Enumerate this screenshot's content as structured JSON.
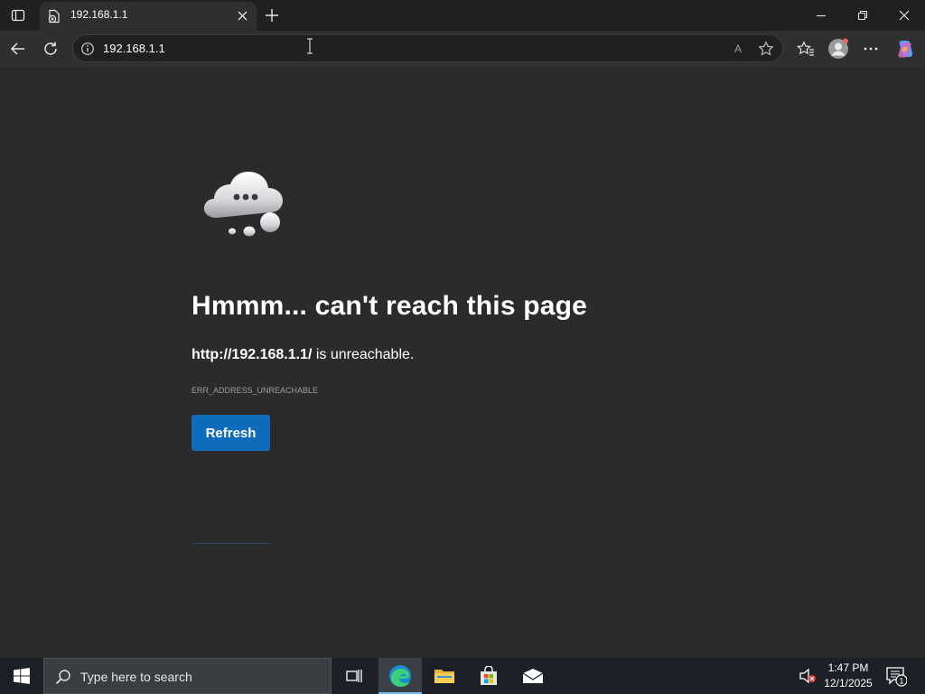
{
  "tab": {
    "title": "192.168.1.1"
  },
  "toolbar": {
    "url": "192.168.1.1",
    "read_aloud_glyph": "A"
  },
  "error_page": {
    "heading": "Hmmm... can't reach this page",
    "url_text": "http://192.168.1.1/",
    "message_suffix": " is unreachable.",
    "error_code": "ERR_ADDRESS_UNREACHABLE",
    "refresh_label": "Refresh"
  },
  "taskbar": {
    "search_placeholder": "Type here to search",
    "time": "1:47 PM",
    "date": "12/1/2025",
    "notification_count": "1"
  },
  "colors": {
    "page_background": "#2b2b2b",
    "accent": "#0f6cbd",
    "taskbar": "#1c2027"
  }
}
